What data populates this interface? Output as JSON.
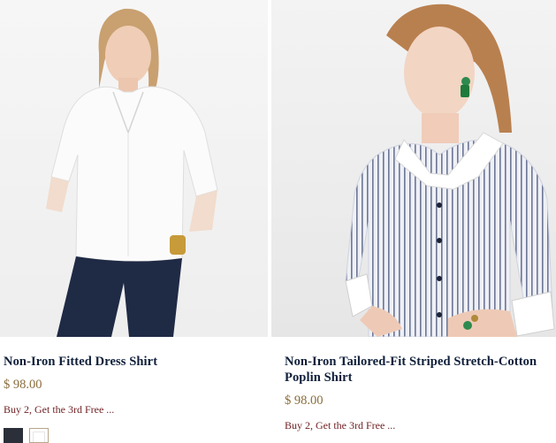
{
  "products": [
    {
      "name": "Non-Iron Fitted Dress Shirt",
      "price": "$ 98.00",
      "promo": "Buy 2, Get the 3rd Free ...",
      "swatches": [
        {
          "name": "navy",
          "color": "#2a2f3a"
        },
        {
          "name": "white",
          "color": "#ffffff"
        }
      ]
    },
    {
      "name": "Non-Iron Tailored-Fit Striped Stretch-Cotton Poplin Shirt",
      "price": "$ 98.00",
      "promo": "Buy 2, Get the 3rd Free ..."
    }
  ],
  "colors": {
    "title": "#0f1f3a",
    "price": "#8a6d3b",
    "promo": "#6e1f22"
  }
}
